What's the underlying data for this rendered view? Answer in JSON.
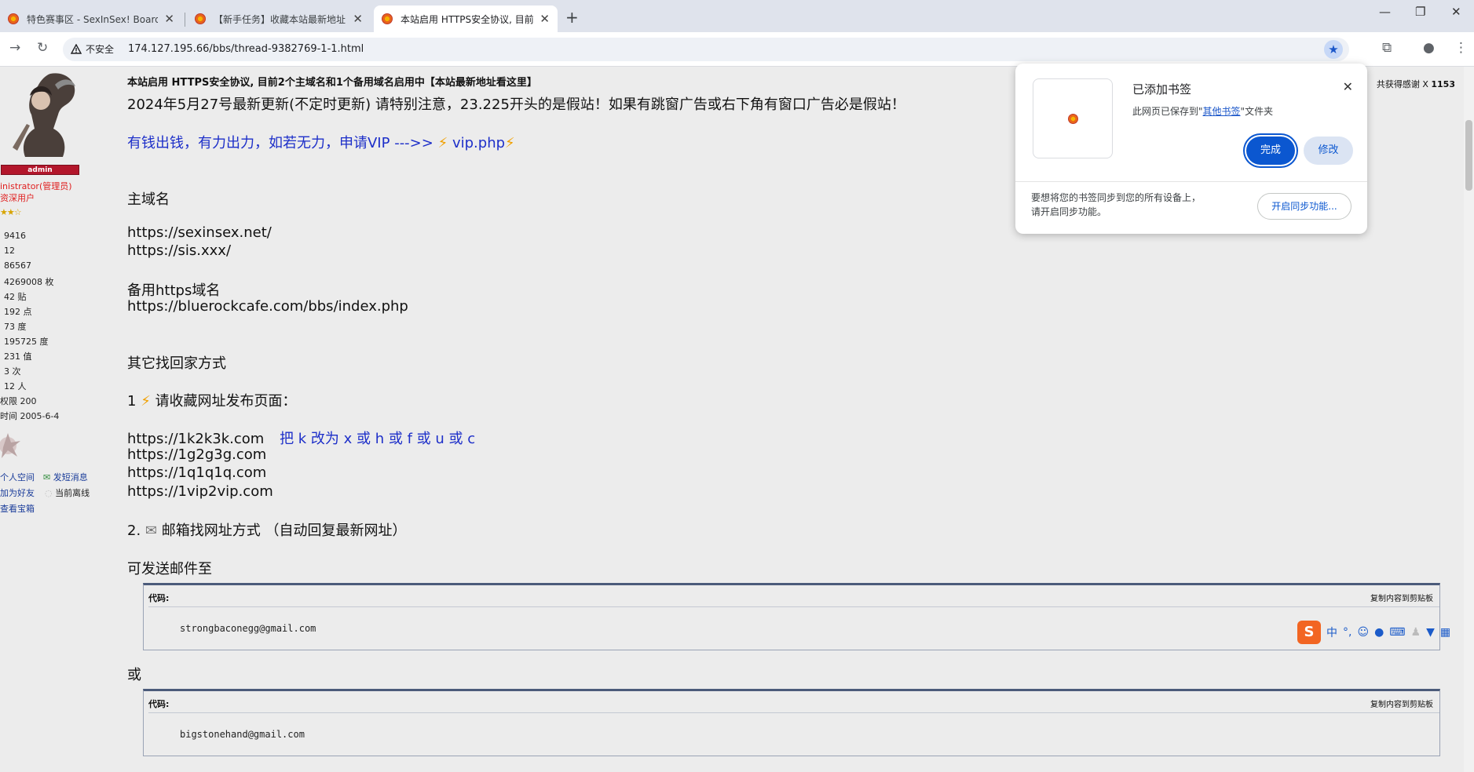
{
  "browser": {
    "tabs": [
      {
        "title": "特色赛事区 - SexInSex! Board",
        "active": false
      },
      {
        "title": "【新手任务】收藏本站最新地址",
        "active": false
      },
      {
        "title": "本站启用 HTTPS安全协议, 目前",
        "active": true
      }
    ],
    "new_tab": "+",
    "window_controls": {
      "minimize": "—",
      "restore": "❐",
      "close": "✕"
    },
    "insecure_label": "不安全",
    "url": "174.127.195.66/bbs/thread-9382769-1-1.html"
  },
  "sidebar": {
    "admin_badge": "admin",
    "role": "inistrator(管理员)",
    "group": "资深用户",
    "stars": "★★☆",
    "stats": [
      "9416",
      "12",
      "86567",
      "4269008 枚",
      "42 贴",
      "192 点",
      "73 度",
      "195725 度",
      "231 值",
      "3 次",
      "12 人"
    ],
    "permission": "权限  200",
    "reg_time": "时间  2005-6-4",
    "links": {
      "space": "个人空间",
      "message": "发短消息",
      "friend": "加为好友",
      "status": "当前离线",
      "treasure": "查看宝箱"
    }
  },
  "post": {
    "title": "本站启用 HTTPS安全协议, 目前2个主域名和1个备用域名启用中【本站最新地址看这里】",
    "thanks": "共获得感谢 X ",
    "thanks_count": "1153",
    "update_note": "2024年5月27号最新更新(不定时更新) 请特别注意，23.225开头的是假站！如果有跳窗广告或右下角有窗口广告必是假站！",
    "vip_text": "有钱出钱，有力出力，如若无力，申请VIP --->>",
    "vip_link": "vip.php",
    "main_domain_heading": "主域名",
    "main_domains": [
      "https://sexinsex.net/",
      "https://sis.xxx/"
    ],
    "backup_heading": "备用https域名",
    "backup_domain": "https://bluerockcafe.com/bbs/index.php",
    "other_heading": "其它找回家方式",
    "step1_num": "1",
    "step1_text": "请收藏网址发布页面：",
    "sites": [
      "https://1k2k3k.com",
      "https://1g2g3g.com",
      "https://1q1q1q.com",
      "https://1vip2vip.com"
    ],
    "site_note": "把 k 改为 x 或 h 或 f 或 u 或 c",
    "step2_num": "2.",
    "step2_text": "邮箱找网址方式 （自动回复最新网址）",
    "send_to": "可发送邮件至",
    "or": "或",
    "code_label": "代码:",
    "copy_label": "复制内容到剪贴板",
    "emails": [
      "strongbaconegg@gmail.com",
      "bigstonehand@gmail.com"
    ]
  },
  "bookmark_popup": {
    "title": "已添加书签",
    "desc_pre": "此网页已保存到\"",
    "folder": "其他书签",
    "desc_post": "\"文件夹",
    "done": "完成",
    "edit": "修改",
    "sync_text": "要想将您的书签同步到您的所有设备上，请开启同步功能。",
    "sync_button": "开启同步功能..."
  },
  "ime": {
    "logo": "S",
    "mode": "中",
    "punct": "°,"
  }
}
